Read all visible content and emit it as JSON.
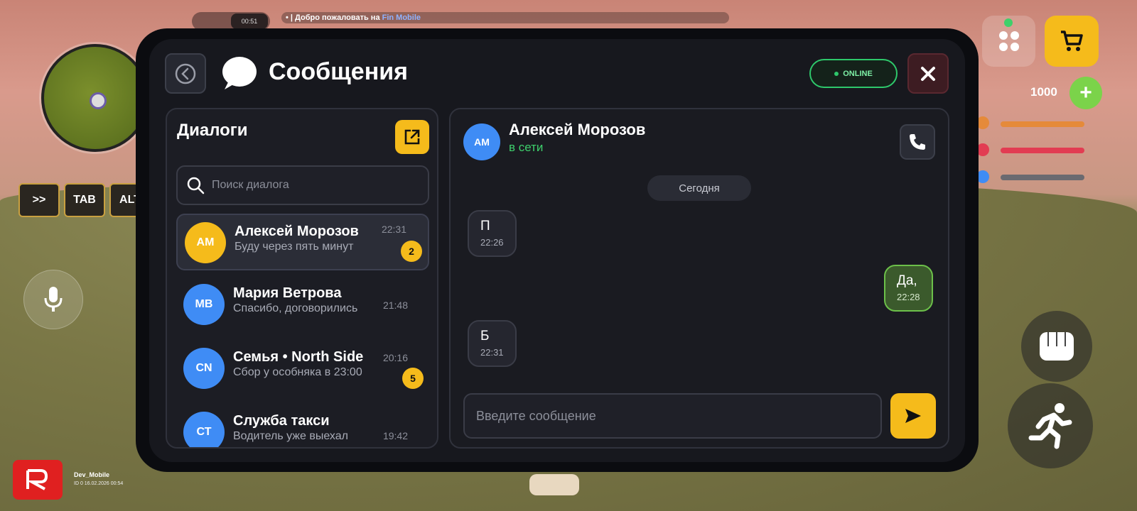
{
  "hud": {
    "clock": "00:51",
    "notice_prefix": "Добро пожаловать на ",
    "notice_brand": "Fin Mobile",
    "keys": [
      ">>",
      "TAB",
      "ALT"
    ],
    "money": "1000",
    "money_plus": "+",
    "player_name": "Dev_Mobile",
    "player_info": "ID 0 16.02.2026 00:54",
    "stat_colors": [
      "#e58a3a",
      "#e23c52",
      "#6a6a70"
    ]
  },
  "app": {
    "title": "Сообщения",
    "status": "ONLINE"
  },
  "dialogs": {
    "title": "Диалоги",
    "search_placeholder": "Поиск диалога",
    "items": [
      {
        "initials": "АМ",
        "name": "Алексей Морозов",
        "last": "Буду через пять минут",
        "time": "22:31",
        "badge": "2",
        "color": "#f5bb1b"
      },
      {
        "initials": "МВ",
        "name": "Мария Ветрова",
        "last": "Спасибо, договорились",
        "time": "21:48",
        "badge": "",
        "color": "#3f8cf5"
      },
      {
        "initials": "CN",
        "name": "Семья • North Side",
        "last": "Сбор у особняка в 23:00",
        "time": "20:16",
        "badge": "5",
        "color": "#3f8cf5"
      },
      {
        "initials": "СТ",
        "name": "Служба такси",
        "last": "Водитель уже выехал",
        "time": "19:42",
        "badge": "",
        "color": "#3f8cf5"
      }
    ]
  },
  "chat": {
    "initials": "АМ",
    "name": "Алексей Морозов",
    "status": "в сети",
    "date_label": "Сегодня",
    "messages": [
      {
        "dir": "in",
        "text": "П",
        "time": "22:26"
      },
      {
        "dir": "out",
        "text": "Да,",
        "time": "22:28"
      },
      {
        "dir": "in",
        "text": "Б",
        "time": "22:31"
      }
    ],
    "input_placeholder": "Введите сообщение"
  },
  "colors": {
    "accent": "#f5bb1b",
    "online": "#2ec86b",
    "avatar_blue": "#3f8cf5",
    "outgoing_bubble": "#3b5a2c"
  }
}
